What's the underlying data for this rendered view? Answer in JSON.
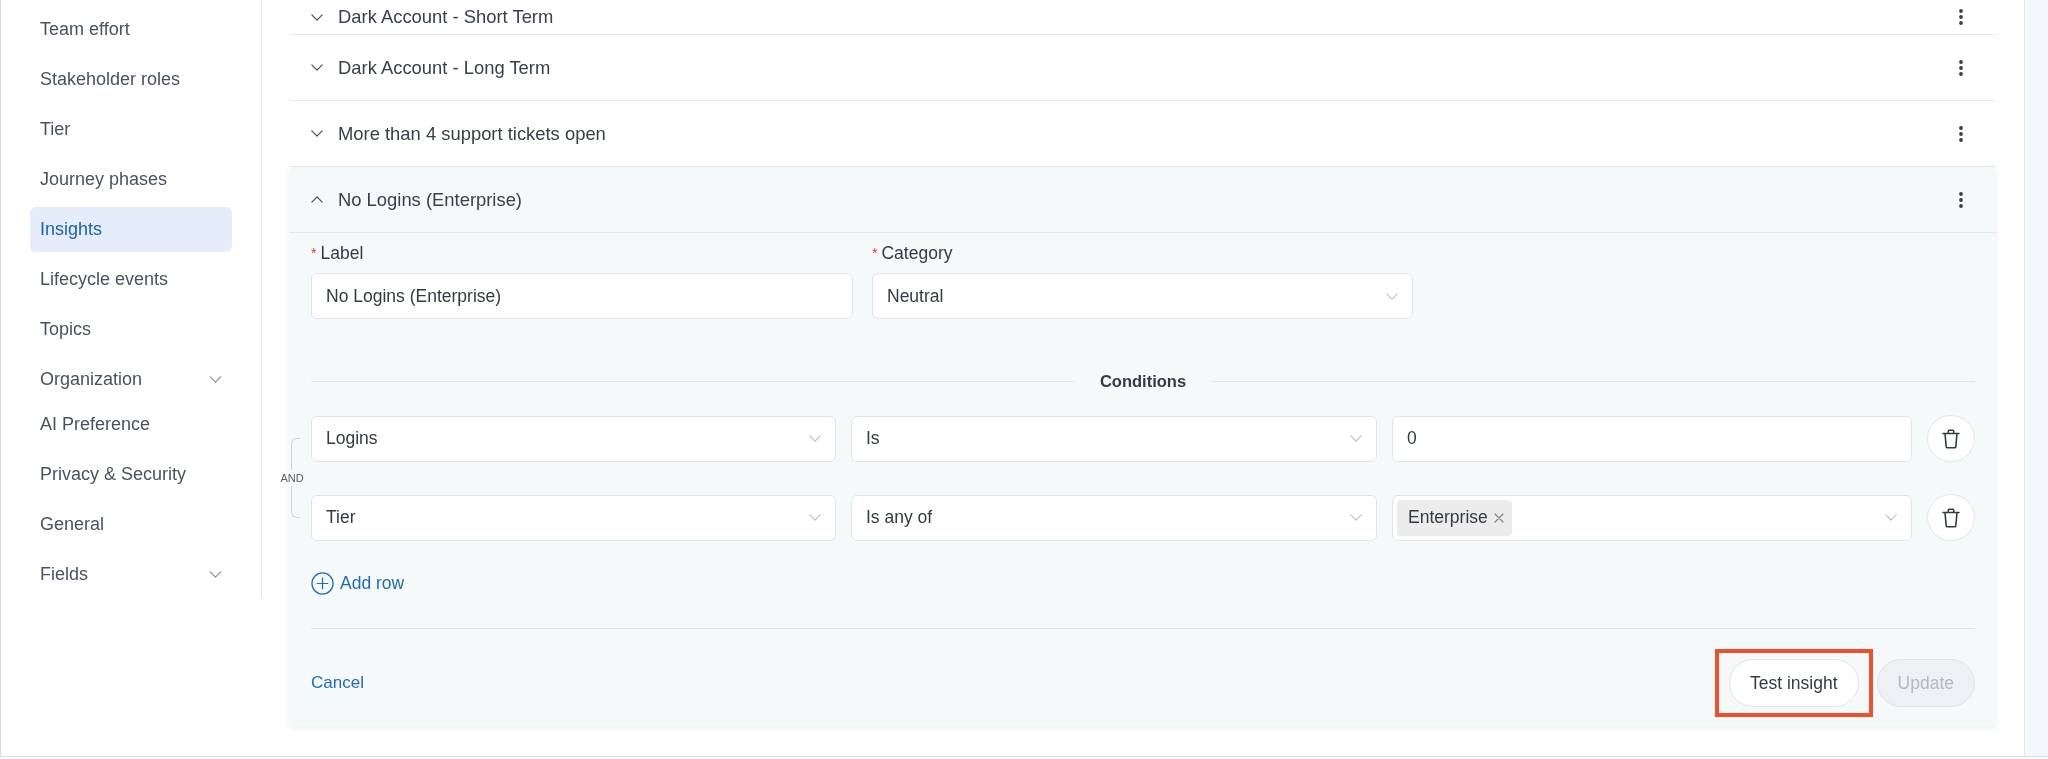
{
  "sidebar": {
    "items": [
      {
        "label": "Team effort",
        "kind": "link",
        "selected": false
      },
      {
        "label": "Stakeholder roles",
        "kind": "link",
        "selected": false
      },
      {
        "label": "Tier",
        "kind": "link",
        "selected": false
      },
      {
        "label": "Journey phases",
        "kind": "link",
        "selected": false
      },
      {
        "label": "Insights",
        "kind": "link",
        "selected": true
      },
      {
        "label": "Lifecycle events",
        "kind": "link",
        "selected": false
      },
      {
        "label": "Topics",
        "kind": "link",
        "selected": false
      },
      {
        "label": "Organization",
        "kind": "group",
        "selected": false
      },
      {
        "label": "AI Preference",
        "kind": "link",
        "selected": false
      },
      {
        "label": "Privacy & Security",
        "kind": "link",
        "selected": false
      },
      {
        "label": "General",
        "kind": "link",
        "selected": false
      },
      {
        "label": "Fields",
        "kind": "group",
        "selected": false
      }
    ]
  },
  "insights": [
    {
      "title": "Dark Account - Short Term",
      "expanded": false
    },
    {
      "title": "Dark Account - Long Term",
      "expanded": false
    },
    {
      "title": "More than 4 support tickets open",
      "expanded": false
    },
    {
      "title": "No Logins (Enterprise)",
      "expanded": true,
      "editor": {
        "fields": [
          {
            "required_mark": "*",
            "label": "Label",
            "kind": "text",
            "value": "No Logins (Enterprise)"
          },
          {
            "required_mark": "*",
            "label": "Category",
            "kind": "select",
            "value": "Neutral"
          }
        ],
        "conditions_title": "Conditions",
        "conjunction": "AND",
        "conditions": [
          {
            "field": "Logins",
            "operator": "Is",
            "kind": "text",
            "value": "0"
          },
          {
            "field": "Tier",
            "operator": "Is any of",
            "kind": "tags",
            "tags": [
              "Enterprise"
            ]
          }
        ],
        "add_row": "Add row",
        "cancel": "Cancel",
        "buttons": [
          {
            "label": "Test insight",
            "disabled": false,
            "highlighted": true
          },
          {
            "label": "Update",
            "disabled": true,
            "highlighted": false
          }
        ]
      }
    }
  ]
}
